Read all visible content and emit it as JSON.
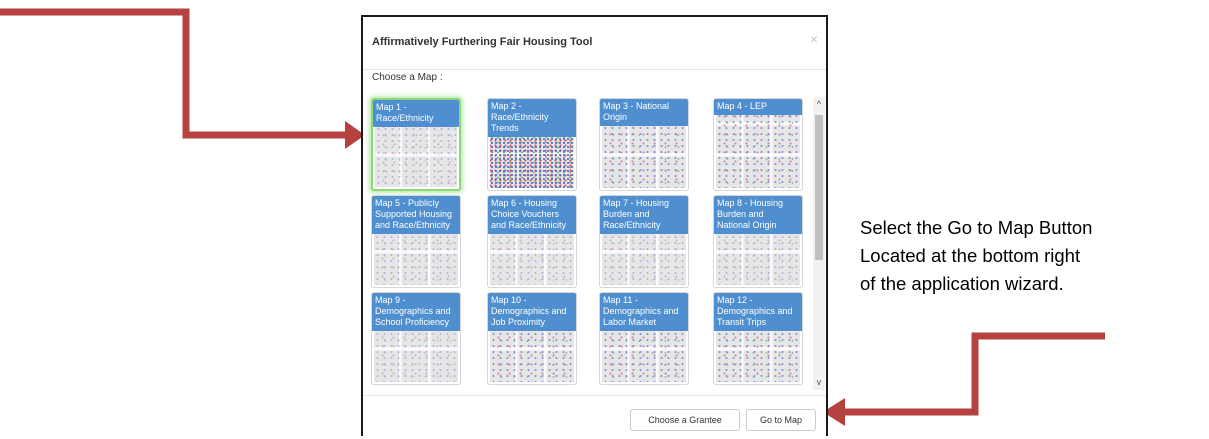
{
  "dialog": {
    "title": "Affirmatively Furthering Fair Housing Tool",
    "close_glyph": "×",
    "choose_label": "Choose a Map :"
  },
  "maps": [
    {
      "label": "Map 1 - Race/Ethnicity",
      "selected": true
    },
    {
      "label": "Map 2 - Race/Ethnicity Trends",
      "selected": false
    },
    {
      "label": "Map 3 - National Origin",
      "selected": false
    },
    {
      "label": "Map 4 - LEP",
      "selected": false
    },
    {
      "label": "Map 5 - Publicly Supported Housing and Race/Ethnicity",
      "selected": false
    },
    {
      "label": "Map 6 - Housing Choice Vouchers and Race/Ethnicity",
      "selected": false
    },
    {
      "label": "Map 7 - Housing Burden and Race/Ethnicity",
      "selected": false
    },
    {
      "label": "Map 8 - Housing Burden and National Origin",
      "selected": false
    },
    {
      "label": "Map 9 - Demographics and School Proficiency",
      "selected": false
    },
    {
      "label": "Map 10 - Demographics and Job Proximity",
      "selected": false
    },
    {
      "label": "Map 11 - Demographics and Labor Market",
      "selected": false
    },
    {
      "label": "Map 12 - Demographics and Transit Trips",
      "selected": false
    }
  ],
  "footer": {
    "choose_grantee_label": "Choose a Grantee",
    "go_to_map_label": "Go to Map"
  },
  "scrollbar": {
    "up_glyph": "^",
    "down_glyph": "v"
  },
  "instruction": {
    "line1": "Select the Go to Map Button",
    "line2": "Located at the bottom right",
    "line3": "of the application wizard."
  },
  "colors": {
    "arrow": "#b5423f",
    "tile_caption": "#4f8fd0",
    "selected_glow": "#8ed67a"
  }
}
